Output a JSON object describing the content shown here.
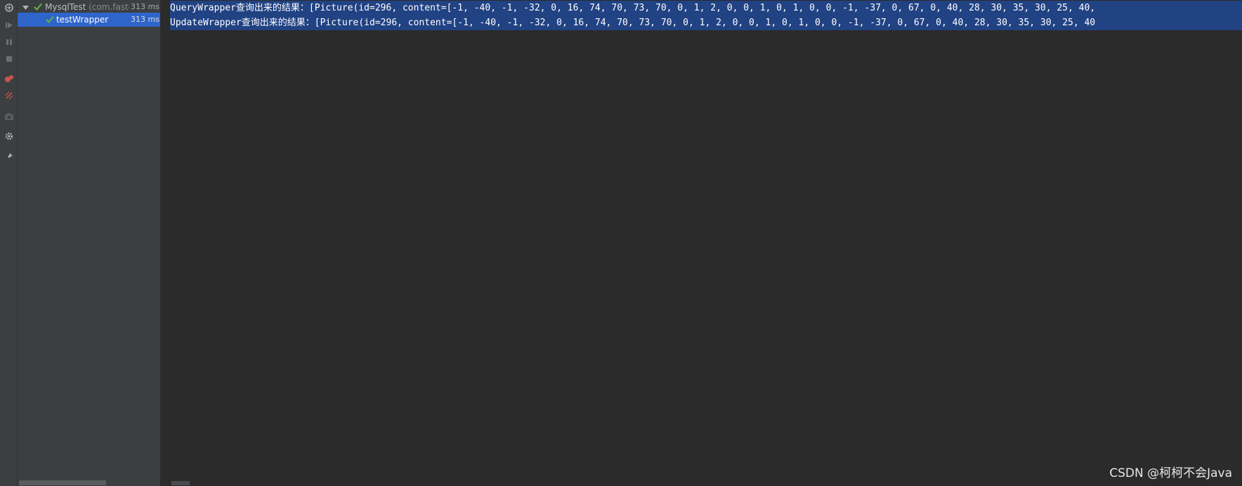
{
  "toolbar": {
    "icons": [
      "rerun-icon",
      "resume-icon",
      "pause-icon",
      "stop-icon",
      "rerun-failed-icon",
      "toggle-auto-test-icon",
      "screenshot-icon",
      "settings-icon",
      "pin-icon"
    ]
  },
  "test_tree": {
    "root": {
      "name": "MysqlTest",
      "package": "(com.faste",
      "time": "313 ms",
      "status": "passed"
    },
    "children": [
      {
        "name": "testWrapper",
        "time": "313 ms",
        "status": "passed",
        "selected": true
      }
    ]
  },
  "console": {
    "lines": [
      "QueryWrapper查询出来的结果：[Picture(id=296, content=[-1, -40, -1, -32, 0, 16, 74, 70, 73, 70, 0, 1, 2, 0, 0, 1, 0, 1, 0, 0, -1, -37, 0, 67, 0, 40, 28, 30, 35, 30, 25, 40,",
      "UpdateWrapper查询出来的结果：[Picture(id=296, content=[-1, -40, -1, -32, 0, 16, 74, 70, 73, 70, 0, 1, 2, 0, 0, 1, 0, 1, 0, 0, -1, -37, 0, 67, 0, 40, 28, 30, 35, 30, 25, 40"
    ],
    "selection_color": "#214283"
  },
  "watermark": "CSDN @柯柯不会Java",
  "colors": {
    "panel_bg": "#3c3f41",
    "console_bg": "#2b2b2b",
    "selected_row": "#2f65ca",
    "passed_green": "#62b543"
  }
}
